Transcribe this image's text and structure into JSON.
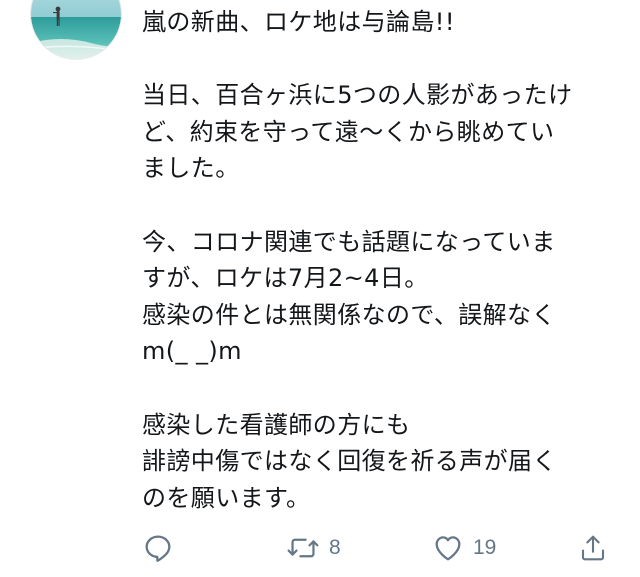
{
  "tweet": {
    "lines": [
      "嵐の新曲、ロケ地は与論島!!",
      "",
      "当日、百合ヶ浜に5つの人影があったけ",
      "ど、約束を守って遠〜くから眺めてい",
      "ました。",
      "",
      "今、コロナ関連でも話題になっていま",
      "すが、ロケは7月2~4日。",
      "感染の件とは無関係なので、誤解なく",
      "m(_ _)m",
      "",
      "感染した看護師の方にも",
      "誹謗中傷ではなく回復を祈る声が届く",
      "のを願います。"
    ]
  },
  "actions": {
    "reply": {
      "icon": "reply-icon"
    },
    "retweet": {
      "icon": "retweet-icon",
      "count": "8"
    },
    "like": {
      "icon": "heart-icon",
      "count": "19"
    },
    "share": {
      "icon": "share-icon"
    }
  },
  "colors": {
    "text": "#14171a",
    "icon": "#657786",
    "avatar_sea": "#3aa7a3",
    "avatar_sky": "#9fd4dc"
  }
}
